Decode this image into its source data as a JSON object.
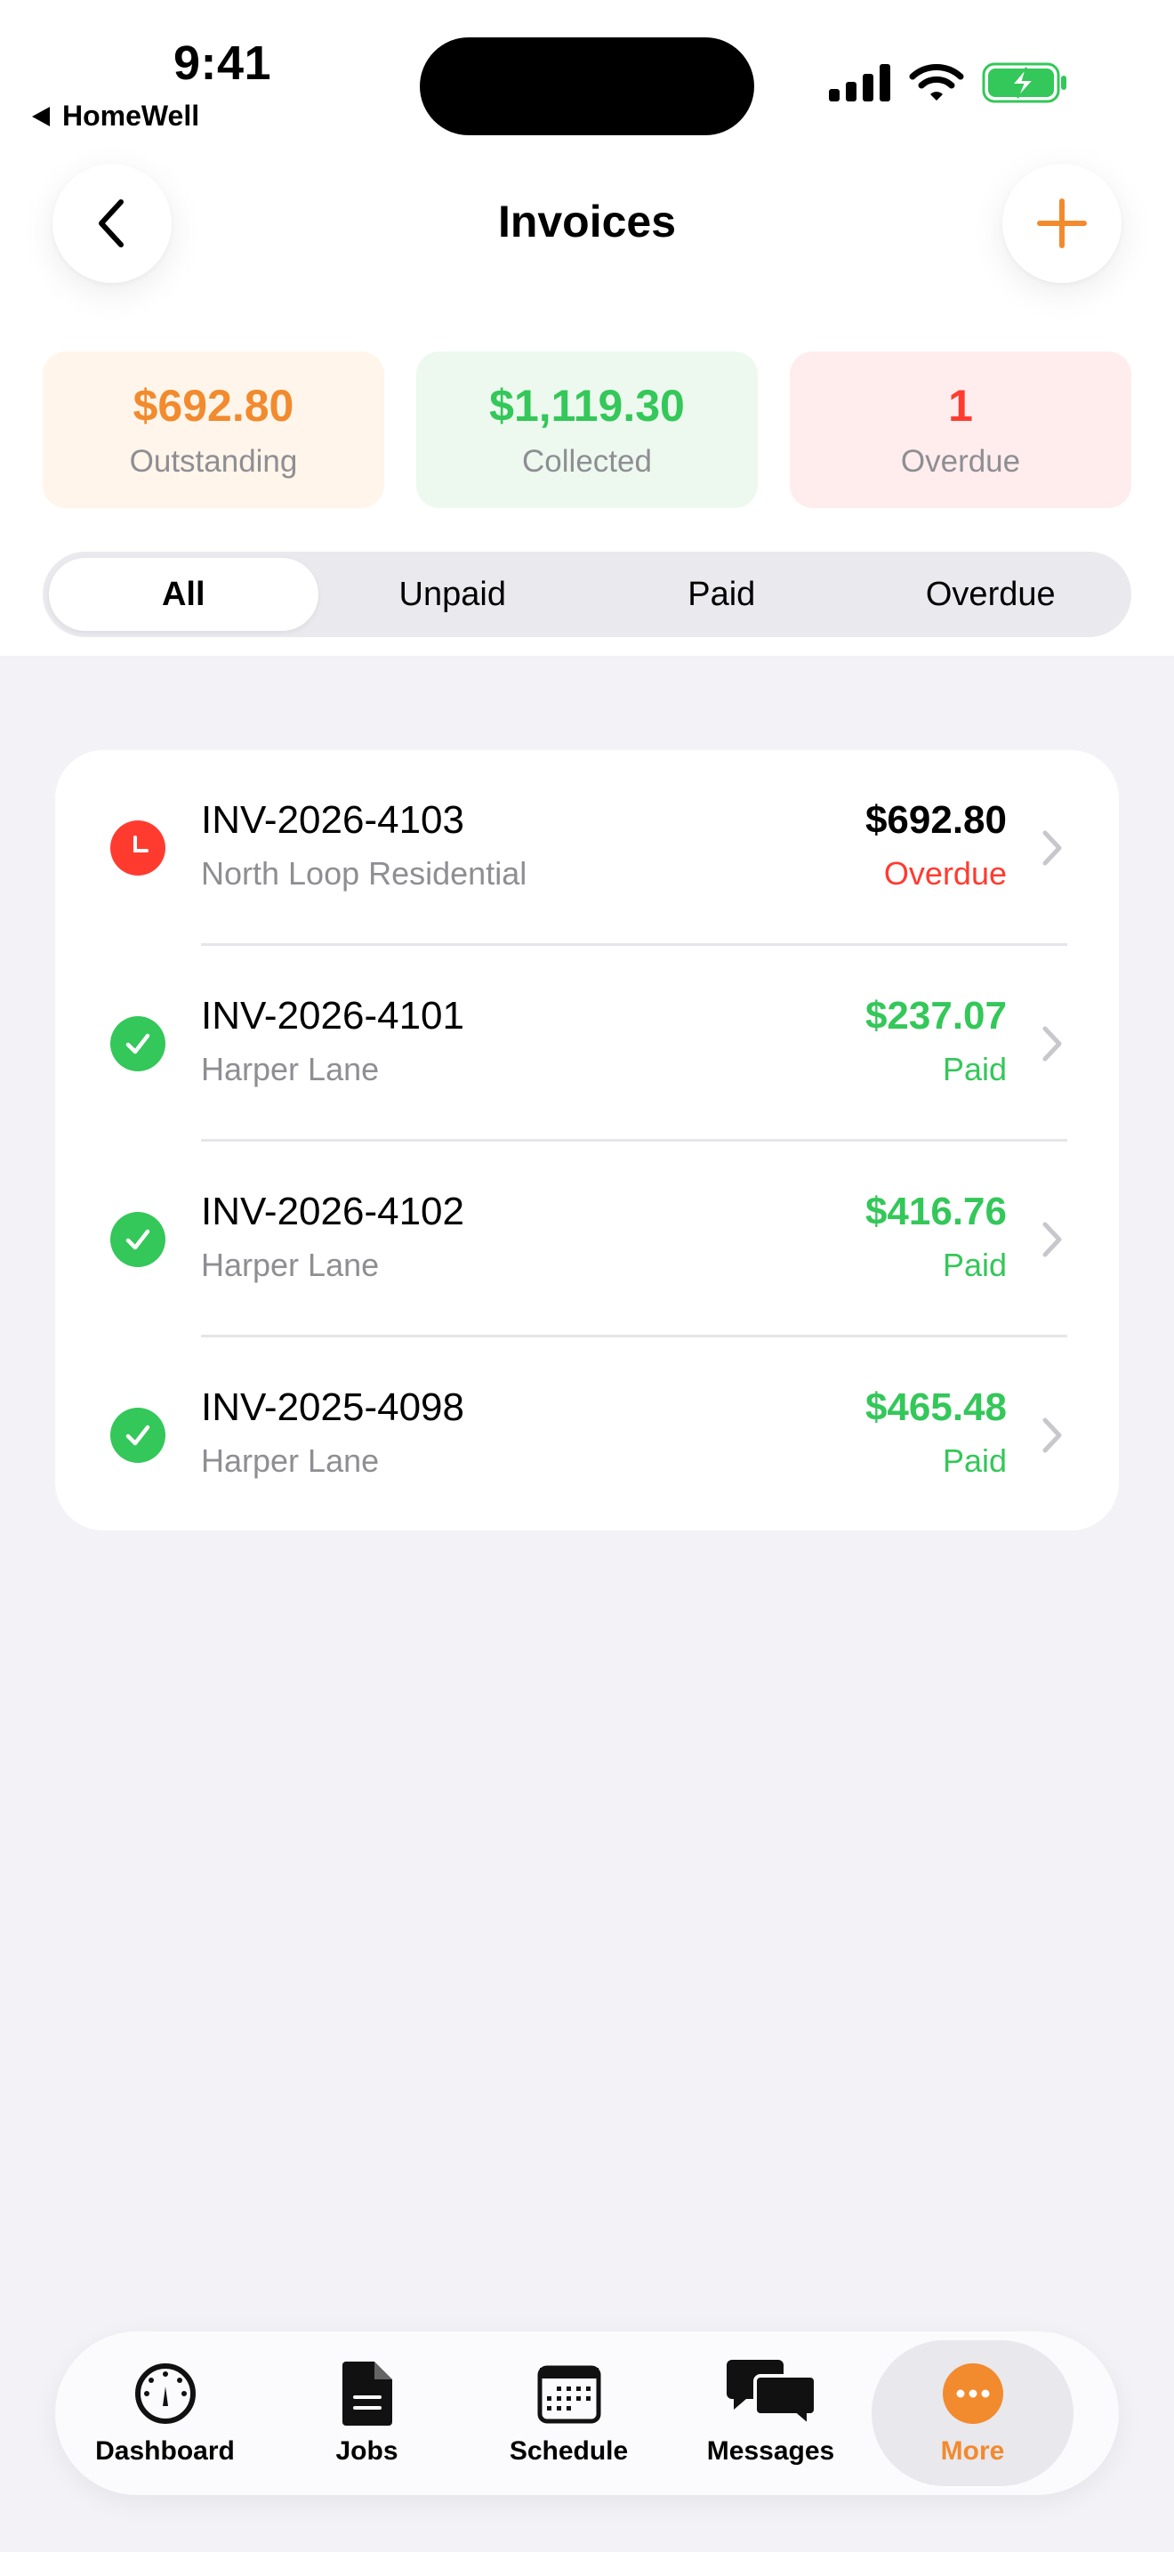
{
  "colors": {
    "accent": "#f28a2e",
    "paid": "#34c759",
    "overdue": "#ff3b30",
    "secondary_text": "#8e8e93"
  },
  "status_bar": {
    "time": "9:41",
    "back_app": "HomeWell",
    "icons": [
      "signal-icon",
      "wifi-icon",
      "battery-charging-icon"
    ]
  },
  "header": {
    "title": "Invoices",
    "back_icon": "chevron-left-icon",
    "add_icon": "plus-icon"
  },
  "summary": [
    {
      "value": "$692.80",
      "label": "Outstanding"
    },
    {
      "value": "$1,119.30",
      "label": "Collected"
    },
    {
      "value": "1",
      "label": "Overdue"
    }
  ],
  "filters": {
    "tabs": [
      "All",
      "Unpaid",
      "Paid",
      "Overdue"
    ],
    "selected": "All"
  },
  "invoices": [
    {
      "id": "INV-2026-4103",
      "client": "North Loop Residential",
      "amount": "$692.80",
      "status": "Overdue",
      "icon": "clock-icon"
    },
    {
      "id": "INV-2026-4101",
      "client": "Harper Lane",
      "amount": "$237.07",
      "status": "Paid",
      "icon": "checkmark-icon"
    },
    {
      "id": "INV-2026-4102",
      "client": "Harper Lane",
      "amount": "$416.76",
      "status": "Paid",
      "icon": "checkmark-icon"
    },
    {
      "id": "INV-2025-4098",
      "client": "Harper Lane",
      "amount": "$465.48",
      "status": "Paid",
      "icon": "checkmark-icon"
    }
  ],
  "tabbar": [
    {
      "label": "Dashboard",
      "icon": "gauge-icon"
    },
    {
      "label": "Jobs",
      "icon": "document-icon"
    },
    {
      "label": "Schedule",
      "icon": "calendar-icon"
    },
    {
      "label": "Messages",
      "icon": "chat-bubbles-icon"
    },
    {
      "label": "More",
      "icon": "more-icon",
      "active": true
    }
  ]
}
